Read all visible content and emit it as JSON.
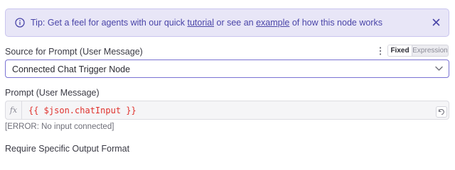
{
  "tip": {
    "icon": "info-icon",
    "prefix": "Tip: Get a feel for agents with our quick ",
    "link1": "tutorial",
    "middle": " or see an ",
    "link2": "example",
    "suffix": " of how this node works",
    "close_icon": "close-icon",
    "accent": "#4a45a8",
    "background": "#e8e6f7"
  },
  "source": {
    "label": "Source for Prompt (User Message)",
    "toggle": {
      "fixed": "Fixed",
      "expression": "Expression",
      "selected": "Fixed"
    },
    "select_value": "Connected Chat Trigger Node"
  },
  "prompt": {
    "label": "Prompt (User Message)",
    "fx": "fx",
    "expression": "{{ $json.chatInput }}",
    "error": "[ERROR: No input connected]",
    "expression_color": "#e0322d"
  },
  "output_format": {
    "label": "Require Specific Output Format"
  }
}
